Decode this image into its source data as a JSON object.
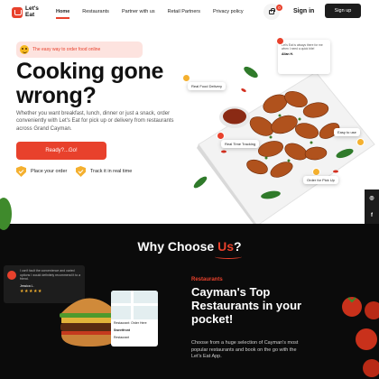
{
  "nav": {
    "logo_text": "Let's Eat",
    "links": [
      "Home",
      "Restaurants",
      "Partner with us",
      "Retail Partners",
      "Privacy policy"
    ],
    "cart_count": "0",
    "signin": "Sign in",
    "signup": "Sign up"
  },
  "hero": {
    "tagline": "The easy way to order food online",
    "headline": "Cooking gone wrong?",
    "description": "Whether you want breakfast, lunch, dinner or just a snack, order conveniently with Let's Eat for pick up or delivery from restaurants across Grand Cayman.",
    "cta": "Ready?...Go!",
    "features": [
      "Place your order",
      "Track it in real time"
    ],
    "floating_tags": [
      "Real Food Delivery",
      "Real Time Tracking",
      "Easy to use",
      "Order for Pick Up"
    ],
    "review": {
      "text": "Let's Eat is always there for me when I need a quick bite!",
      "name": "Allan H."
    }
  },
  "social": {
    "icons": [
      "instagram-icon",
      "facebook-icon"
    ],
    "labels": [
      "◎",
      "f"
    ]
  },
  "why": {
    "title_prefix": "Why Choose ",
    "title_accent": "Us",
    "title_suffix": "?",
    "testimonial": {
      "text": "I can't fault the convenience and varied options I would definitely recommend it to a friend.",
      "name": "Jessica L.",
      "stars": "★★★★★"
    },
    "phone": {
      "row1": "Restaurant: Order Here",
      "row2": "Sweetfront",
      "row3": "Restaurant"
    },
    "section_label": "Restaurants",
    "section_title": "Cayman's Top Restaurants in your pocket!",
    "section_desc": "Choose from a huge selection of Cayman's most popular restaurants and book on the go with the Let's Eat App."
  },
  "colors": {
    "accent": "#e8412c",
    "dark": "#0b0b0b",
    "yellow": "#f4b02f"
  }
}
